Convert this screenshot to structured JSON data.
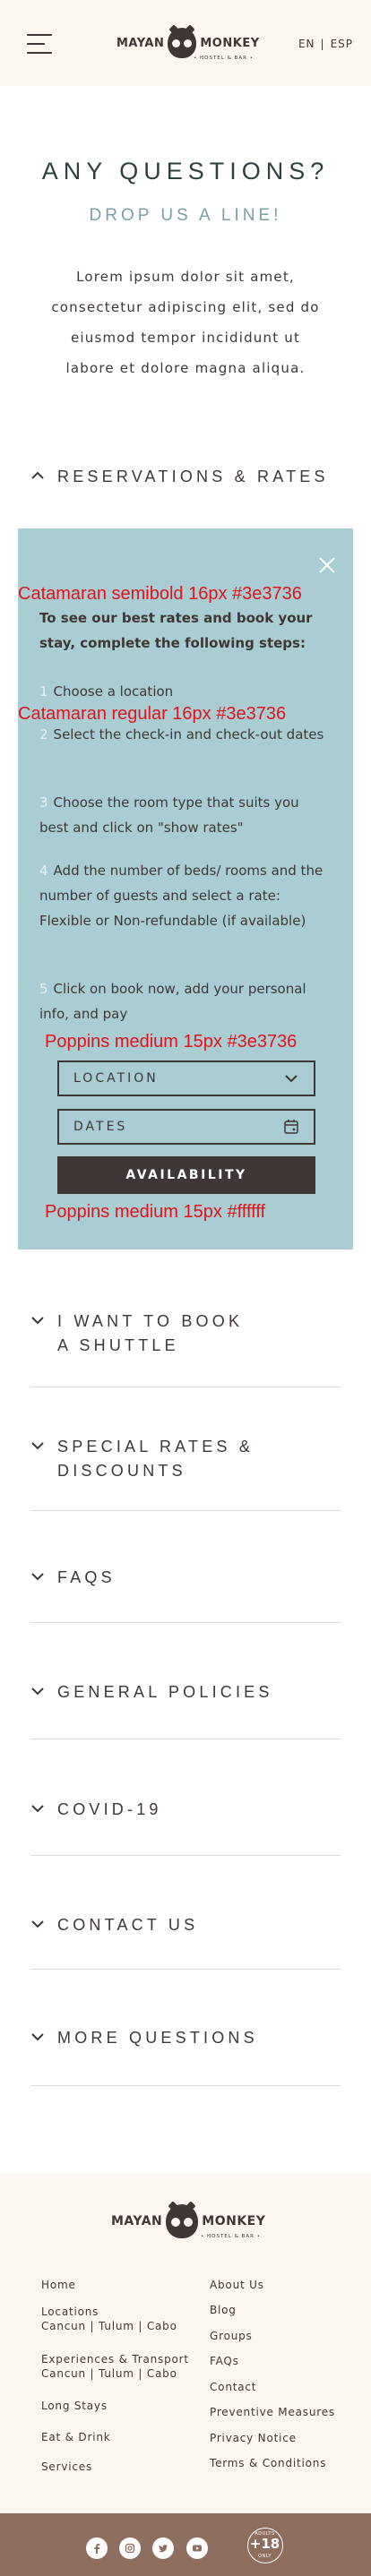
{
  "header": {
    "brand_left": "MAYAN",
    "brand_right": "MONKEY",
    "brand_sub": "• HOSTEL & BAR •",
    "lang_en": "EN",
    "lang_sep": "|",
    "lang_esp": "ESP"
  },
  "hero": {
    "title": "ANY QUESTIONS?",
    "subtitle": "DROP US A LINE!",
    "body": "Lorem ipsum dolor sit amet, consectetur adipiscing elit, sed do eiusmod tempor incididunt ut labore et dolore magna aliqua."
  },
  "accordion": {
    "reservations": "RESERVATIONS & RATES",
    "shuttle_1": "I WANT TO BOOK",
    "shuttle_2": "A SHUTTLE",
    "special_1": "SPECIAL RATES &",
    "special_2": "DISCOUNTS",
    "faqs": "FAQS",
    "policies": "GENERAL POLICIES",
    "covid": "COVID-19",
    "contact": "CONTACT US",
    "more": "MORE QUESTIONS"
  },
  "panel": {
    "intro": "To see our best rates and book your stay, complete the following steps:",
    "steps": [
      {
        "num": "1",
        "text": "Choose a location"
      },
      {
        "num": "2",
        "text": "Select the check-in and check-out dates"
      },
      {
        "num": "3",
        "text": "Choose the room type that suits you best and click on \"show rates\""
      },
      {
        "num": "4",
        "text": "Add the number of beds/ rooms and the number of guests and select a rate: Flexible or Non-refundable (if available)"
      },
      {
        "num": "5",
        "text": "Click on book now, add your personal info, and pay"
      }
    ],
    "location_placeholder": "LOCATION",
    "dates_placeholder": "DATES",
    "availability": "AVAILABILITY"
  },
  "annotations": {
    "a1": "Catamaran semibold 16px #3e3736",
    "a2": "Catamaran regular 16px #3e3736",
    "a3": "Poppins medium 15px #3e3736",
    "a4": "Poppins medium 15px #ffffff"
  },
  "footer": {
    "brand_left": "MAYAN",
    "brand_right": "MONKEY",
    "brand_sub": "• HOSTEL & BAR •",
    "left_links": {
      "home": "Home",
      "locations": "Locations",
      "locations_sub": "Cancun | Tulum | Cabo",
      "experiences": "Experiences & Transport",
      "experiences_sub": "Cancun | Tulum | Cabo",
      "long_stays": "Long Stays",
      "eat_drink": "Eat & Drink",
      "services": "Services"
    },
    "right_links": {
      "about": "About Us",
      "blog": "Blog",
      "groups": "Groups",
      "faqs": "FAQs",
      "contact": "Contact",
      "preventive": "Preventive Measures",
      "privacy": "Privacy Notice",
      "terms": "Terms & Conditions"
    },
    "badge_big": "+18",
    "badge_top": "ADULTS",
    "badge_bottom": "ONLY"
  },
  "colors": {
    "dark": "#3e3736",
    "panel_bg": "#aacdd3",
    "cream": "#fcf6f1",
    "footer_bar": "#8d6e5f",
    "annotation": "#e0131a",
    "teal_title": "#2e4140",
    "subtitle": "#7aa0a6"
  },
  "icons": [
    "hamburger-icon",
    "chevron-up-icon",
    "chevron-down-icon",
    "close-icon",
    "calendar-icon",
    "facebook-icon",
    "instagram-icon",
    "twitter-icon",
    "youtube-icon"
  ]
}
